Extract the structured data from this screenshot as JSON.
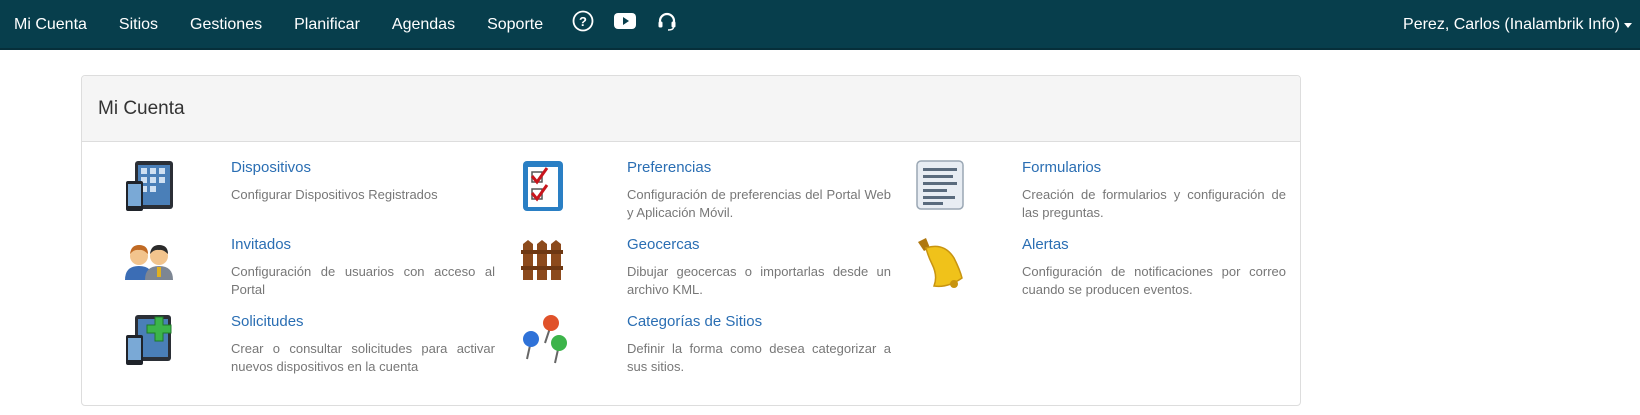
{
  "nav": {
    "items": [
      "Mi Cuenta",
      "Sitios",
      "Gestiones",
      "Planificar",
      "Agendas",
      "Soporte"
    ],
    "icons": [
      "help-icon",
      "youtube-icon",
      "headset-icon"
    ],
    "user": "Perez, Carlos (Inalambrik Info)"
  },
  "panel": {
    "title": "Mi Cuenta",
    "items": [
      {
        "title": "Dispositivos",
        "desc": "Configurar Dispositivos Registrados",
        "icon": "devices-icon"
      },
      {
        "title": "Preferencias",
        "desc": "Configuración de preferencias del Portal Web y Aplicación Móvil.",
        "icon": "checklist-icon"
      },
      {
        "title": "Formularios",
        "desc": "Creación de formularios y configuración de las preguntas.",
        "icon": "form-icon"
      },
      {
        "title": "Invitados",
        "desc": "Configuración de usuarios con acceso al Portal",
        "icon": "users-icon"
      },
      {
        "title": "Geocercas",
        "desc": "Dibujar geocercas o importarlas desde un archivo KML.",
        "icon": "fence-icon"
      },
      {
        "title": "Alertas",
        "desc": "Configuración de notificaciones por correo cuando se producen eventos.",
        "icon": "bell-icon"
      },
      {
        "title": "Solicitudes",
        "desc": "Crear o consultar solicitudes para activar nuevos dispositivos en la cuenta",
        "icon": "add-device-icon"
      },
      {
        "title": "Categorías de Sitios",
        "desc": "Definir la forma como desea categorizar a sus sitios.",
        "icon": "pins-icon"
      }
    ]
  },
  "colors": {
    "navbar": "#073e4c",
    "link": "#2a6eb3",
    "text_muted": "#777777"
  }
}
